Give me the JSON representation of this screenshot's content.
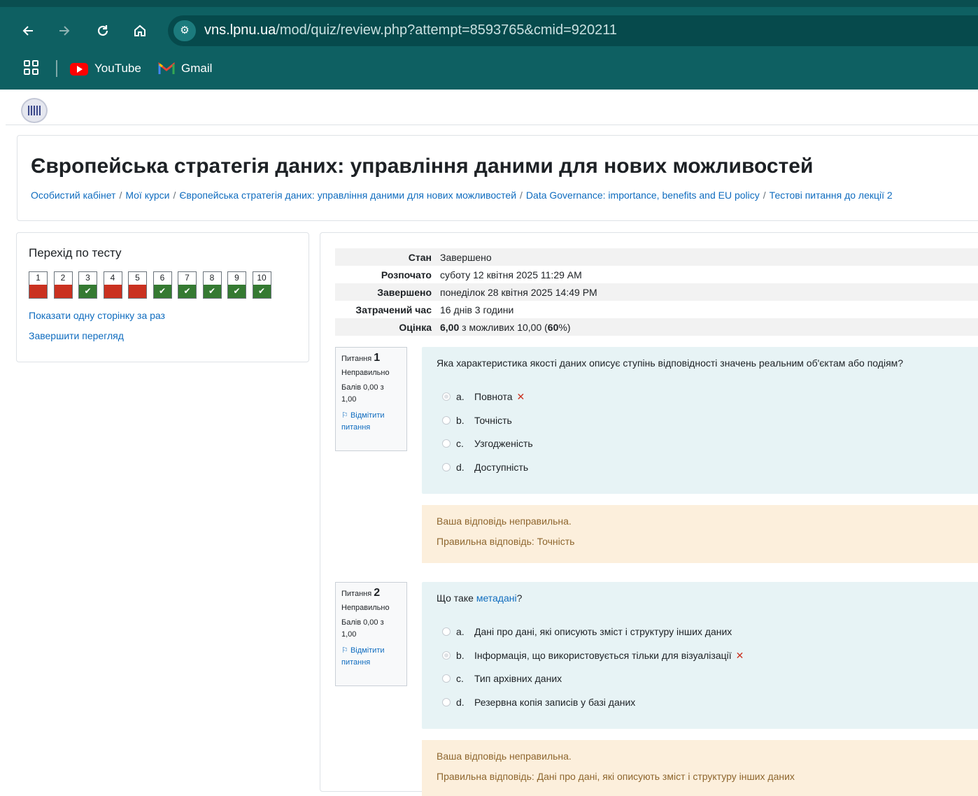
{
  "browser": {
    "url_host": "vns.lpnu.ua",
    "url_path": "/mod/quiz/review.php?attempt=8593765&cmid=920211",
    "back_icon": "arrow-left-icon",
    "forward_icon": "arrow-right-icon",
    "reload_icon": "reload-icon",
    "home_icon": "home-icon",
    "bookmarks": [
      {
        "label": "YouTube",
        "icon": "youtube-icon"
      },
      {
        "label": "Gmail",
        "icon": "gmail-icon"
      }
    ]
  },
  "page": {
    "title": "Європейська стратегія даних: управління даними для нових можливостей",
    "breadcrumb": [
      "Особистий кабінет",
      "Мої курси",
      "Європейська стратегія даних: управління даними для нових можливостей",
      "Data Governance: importance, benefits and EU policy",
      "Тестові питання до лекції 2"
    ]
  },
  "quiz_nav": {
    "title": "Перехід по тесту",
    "buttons": [
      {
        "num": "1",
        "state": "wrong"
      },
      {
        "num": "2",
        "state": "wrong"
      },
      {
        "num": "3",
        "state": "right"
      },
      {
        "num": "4",
        "state": "wrong"
      },
      {
        "num": "5",
        "state": "wrong"
      },
      {
        "num": "6",
        "state": "right"
      },
      {
        "num": "7",
        "state": "right"
      },
      {
        "num": "8",
        "state": "right"
      },
      {
        "num": "9",
        "state": "right"
      },
      {
        "num": "10",
        "state": "right"
      }
    ],
    "check_mark": "✔",
    "show_one_page": "Показати одну сторінку за раз",
    "finish_review": "Завершити перегляд"
  },
  "summary": [
    {
      "label": "Стан",
      "value": "Завершено"
    },
    {
      "label": "Розпочато",
      "value": "суботу 12 квітня 2025 11:29 AM"
    },
    {
      "label": "Завершено",
      "value": "понеділок 28 квітня 2025 14:49 PM"
    },
    {
      "label": "Затрачений час",
      "value": "16 днів 3 години"
    },
    {
      "label": "Оцінка",
      "grade": "6,00",
      "grade_rest": " з можливих 10,00 (",
      "percent": "60",
      "percent_rest": "%)"
    }
  ],
  "questions": [
    {
      "prefix": "Питання",
      "number": "1",
      "status": "Неправильно",
      "mark": "Балів 0,00 з 1,00",
      "flag": "Відмітити питання",
      "text": "Яка характеристика якості даних описує ступінь відповідності значень реальним об'єктам або подіям?",
      "answers": [
        {
          "letter": "a.",
          "text": "Повнота",
          "checked": true,
          "wrong": true
        },
        {
          "letter": "b.",
          "text": "Точність",
          "checked": false,
          "wrong": false
        },
        {
          "letter": "c.",
          "text": "Узгодженість",
          "checked": false,
          "wrong": false
        },
        {
          "letter": "d.",
          "text": "Доступність",
          "checked": false,
          "wrong": false
        }
      ],
      "feedback": "Ваша відповідь неправильна.",
      "right_answer": "Правильна відповідь: Точність"
    },
    {
      "prefix": "Питання",
      "number": "2",
      "status": "Неправильно",
      "mark": "Балів 0,00 з 1,00",
      "flag": "Відмітити питання",
      "text_before": "Що таке ",
      "text_link": "метадані",
      "text_after": "?",
      "answers": [
        {
          "letter": "a.",
          "text": "Дані про дані, які описують зміст і структуру інших даних",
          "checked": false,
          "wrong": false
        },
        {
          "letter": "b.",
          "text": "Інформація, що використовується тільки для візуалізації",
          "checked": true,
          "wrong": true
        },
        {
          "letter": "c.",
          "text": "Тип архівних даних",
          "checked": false,
          "wrong": false
        },
        {
          "letter": "d.",
          "text": "Резервна копія записів у базі даних",
          "checked": false,
          "wrong": false
        }
      ],
      "feedback": "Ваша відповідь неправильна.",
      "right_answer": "Правильна відповідь: Дані про дані, які описують зміст і структуру інших даних"
    }
  ],
  "wrong_mark": "✕"
}
